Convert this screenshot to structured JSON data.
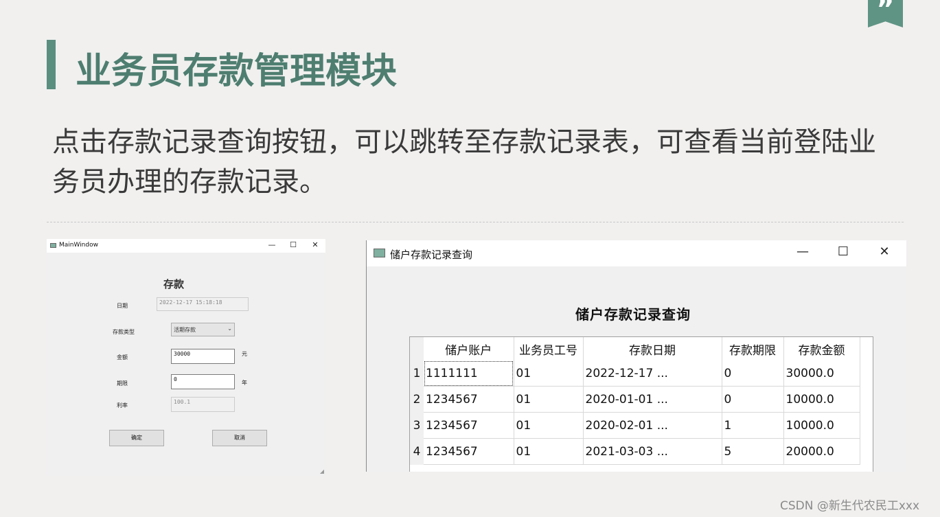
{
  "slide": {
    "title": "业务员存款管理模块",
    "description": "点击存款记录查询按钮，可以跳转至存款记录表，可查看当前登陆业务员办理的存款记录。",
    "watermark": "CSDN @新生代农民工xxx",
    "quote_mark": "”"
  },
  "left_window": {
    "title": "MainWindow",
    "controls": {
      "minimize": "—",
      "maximize": "☐",
      "close": "✕"
    },
    "form_title": "存款",
    "labels": {
      "date": "日期",
      "type": "存款类型",
      "amount": "金额",
      "term": "期限",
      "rate": "利率"
    },
    "values": {
      "date": "2022-12-17 15:18:18",
      "type": "活期存款",
      "amount": "30000",
      "term": "0",
      "rate": "100.1"
    },
    "units": {
      "amount": "元",
      "term": "年"
    },
    "buttons": {
      "ok": "确定",
      "cancel": "取消"
    }
  },
  "right_window": {
    "title": "储户存款记录查询",
    "controls": {
      "minimize": "—",
      "maximize": "☐",
      "close": "✕"
    },
    "table_title": "储户存款记录查询",
    "columns": [
      "储户账户",
      "业务员工号",
      "存款日期",
      "存款期限",
      "存款金额"
    ],
    "rows": [
      {
        "num": "1",
        "cells": [
          "1111111",
          "01",
          "2022-12-17 ...",
          "0",
          "30000.0"
        ]
      },
      {
        "num": "2",
        "cells": [
          "1234567",
          "01",
          "2020-01-01 ...",
          "0",
          "10000.0"
        ]
      },
      {
        "num": "3",
        "cells": [
          "1234567",
          "01",
          "2020-02-01 ...",
          "1",
          "10000.0"
        ]
      },
      {
        "num": "4",
        "cells": [
          "1234567",
          "01",
          "2021-03-03 ...",
          "5",
          "20000.0"
        ]
      }
    ]
  },
  "colors": {
    "accent": "#5a8e7f",
    "title": "#4e7e70",
    "background": "#f1f0ef"
  }
}
